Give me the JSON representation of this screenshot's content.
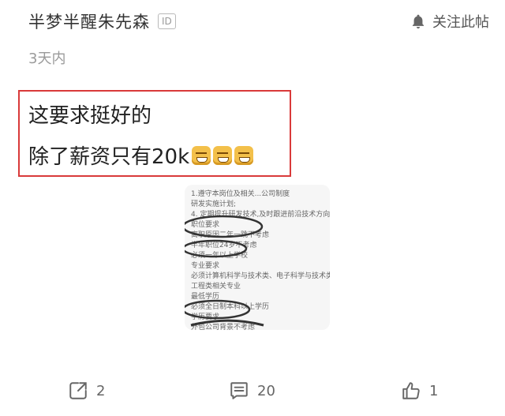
{
  "post": {
    "author": "半梦半醒朱先森",
    "id_badge": "ID",
    "follow_label": "关注此帖",
    "time": "3天内",
    "line1": "这要求挺好的",
    "line2_text": "除了薪资只有20k"
  },
  "image": {
    "lines": [
      "1.遵守本岗位及相关...公司制度",
      "研发实施计划;",
      "4. 定期提升研发技术,及时跟进前沿技术方向。",
      "职位要求",
      "离职原因二年一跳不考虑",
      "半年职位24岁不考虑",
      "必须一年以上学校",
      "专业要求",
      "必须计算机科学与技术类、电子科学与技术类、信息与通信",
      "工程类相关专业",
      "最低学历",
      "必须全日制本科以上学历",
      "学历要求",
      "外包公司背景不考虑"
    ]
  },
  "actions": {
    "share_count": "2",
    "comment_count": "20",
    "like_count": "1"
  }
}
